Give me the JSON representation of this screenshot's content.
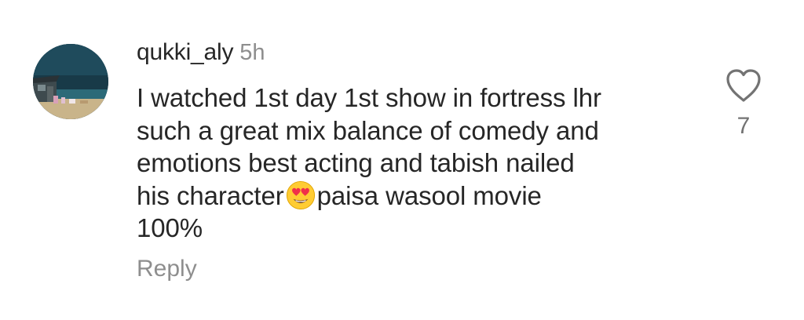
{
  "comment": {
    "username": "qukki_aly",
    "timestamp": "5h",
    "text_part1": "I watched 1st day 1st show in fortress lhr\nsuch a great mix balance of comedy and\nemotions best acting and tabish nailed\nhis character",
    "emoji": "😍",
    "text_part2": "paisa wasool movie\n100%",
    "reply_label": "Reply",
    "like_count": "7",
    "like_icon": "heart-outline-icon",
    "avatar_icon": "profile-avatar"
  },
  "colors": {
    "text": "#262626",
    "secondary": "#8e8e8e",
    "like_count": "#737373",
    "background": "#ffffff"
  }
}
